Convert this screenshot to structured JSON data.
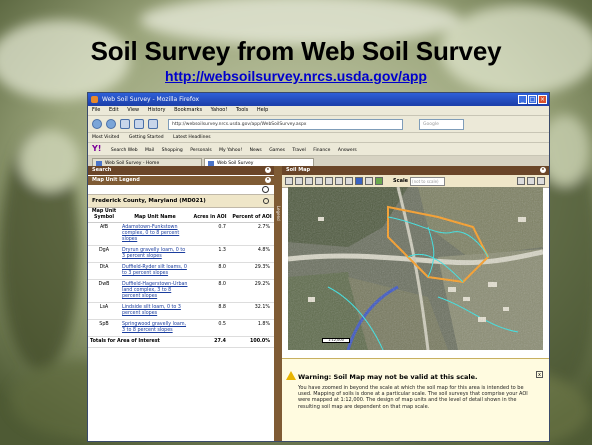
{
  "slide": {
    "title": "Soil Survey from Web Soil Survey",
    "url": "http://websoilsurvey.nrcs.usda.gov/app"
  },
  "browser": {
    "window_title": "Web Soil Survey - Mozilla Firefox",
    "menu": [
      "File",
      "Edit",
      "View",
      "History",
      "Bookmarks",
      "Yahoo!",
      "Tools",
      "Help"
    ],
    "address": "http://websoilsurvey.nrcs.usda.gov/app/WebSoilSurvey.aspx",
    "search_placeholder": "Google",
    "bookmarks": [
      "Most Visited",
      "Getting Started",
      "Latest Headlines"
    ],
    "yahoo_toolbar": [
      "Search Web",
      "Mail",
      "Shopping",
      "Personals",
      "My Yahoo!",
      "News",
      "Games",
      "Travel",
      "Finance",
      "Answers"
    ],
    "tabs": [
      {
        "label": "Web Soil Survey - Home",
        "active": false
      },
      {
        "label": "Web Soil Survey",
        "active": true
      }
    ]
  },
  "left_panel": {
    "search_label": "Search",
    "legend_label": "Map Unit Legend",
    "county": "Frederick County, Maryland (MD021)",
    "columns": [
      "Map Unit Symbol",
      "Map Unit Name",
      "Acres in AOI",
      "Percent of AOI"
    ],
    "rows": [
      {
        "symbol": "AfB",
        "name": "Adamstown-Funkstown complex, 0 to 8 percent slopes",
        "acres": "0.7",
        "percent": "2.7%"
      },
      {
        "symbol": "DgA",
        "name": "Dryrun gravelly loam, 0 to 3 percent slopes",
        "acres": "1.3",
        "percent": "4.8%"
      },
      {
        "symbol": "DtA",
        "name": "Duffield-Ryder silt loams, 0 to 3 percent slopes",
        "acres": "8.0",
        "percent": "29.3%"
      },
      {
        "symbol": "DwB",
        "name": "Duffield-Hagerstown-Urban land complex, 3 to 8 percent slopes",
        "acres": "8.0",
        "percent": "29.2%"
      },
      {
        "symbol": "LsA",
        "name": "Lindside silt loam, 0 to 3 percent slopes",
        "acres": "8.8",
        "percent": "32.1%"
      },
      {
        "symbol": "SpB",
        "name": "Springwood gravelly loam, 3 to 8 percent slopes",
        "acres": "0.5",
        "percent": "1.8%"
      }
    ],
    "total": {
      "label": "Totals for Area of Interest",
      "acres": "27.4",
      "percent": "100.0%"
    }
  },
  "splitter_label": "Legend",
  "right_panel": {
    "title": "Soil Map",
    "scale_label": "Scale",
    "scale_placeholder": "(not to scale)",
    "scalebar_label": "1:12,000",
    "warning_title": "Warning: Soil Map may not be valid at this scale.",
    "warning_body": "You have zoomed in beyond the scale at which the soil map for this area is intended to be used. Mapping of soils is done at a particular scale. The soil surveys that comprise your AOI were mapped at 1:12,000. The design of map units and the level of detail shown in the resulting soil map are dependent on that map scale."
  },
  "colors": {
    "title": "#000000",
    "url": "#0000cc",
    "panel_brown": "#6a4528",
    "aoi_outline": "#ff9d1e",
    "soil_lines": "#30e6e6"
  }
}
